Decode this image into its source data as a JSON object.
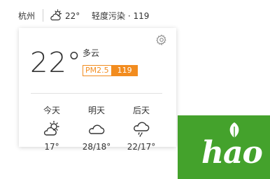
{
  "topbar": {
    "city": "杭州",
    "temp": "22°",
    "aqi_text": "轻度污染 · 119",
    "weather_icon": "partly-cloudy-icon"
  },
  "card": {
    "temperature": "22°",
    "condition": "多云",
    "pm_label": "PM2.5",
    "pm_value": "119",
    "settings_icon": "gear-icon",
    "forecast": [
      {
        "label": "今天",
        "icon": "partly-cloudy-icon",
        "temp": "17°"
      },
      {
        "label": "明天",
        "icon": "cloudy-icon",
        "temp": "28/18°"
      },
      {
        "label": "后天",
        "icon": "rain-icon",
        "temp": "22/17°"
      }
    ]
  },
  "logo": {
    "text": "hao"
  },
  "colors": {
    "pm_accent": "#f28c1f",
    "logo_green": "#44a22c"
  }
}
